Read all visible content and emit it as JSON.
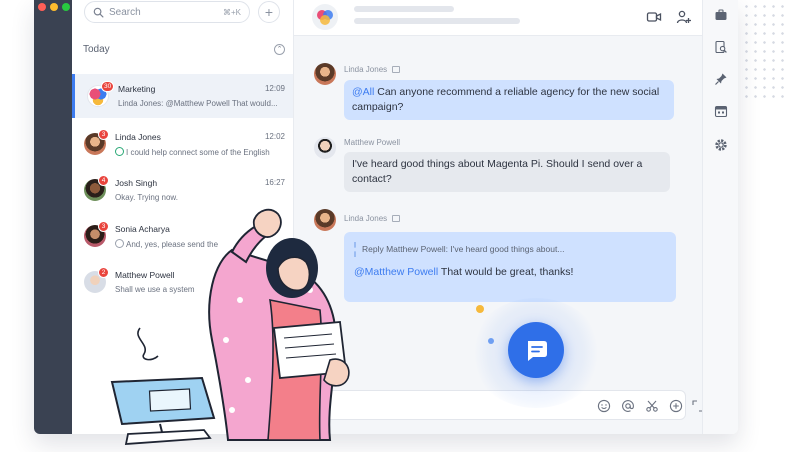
{
  "colors": {
    "accent": "#3d7cf0",
    "rail": "#3a4252",
    "badge": "#e9443d",
    "bubble_mine": "#cfe1ff",
    "bubble_other": "#e6e9ee"
  },
  "search": {
    "placeholder": "Search",
    "shortcut": "⌘+K"
  },
  "sidebar": {
    "section_label": "Today",
    "conversations": [
      {
        "name": "Marketing",
        "time": "12:09",
        "preview": "Linda Jones: @Matthew Powell That would...",
        "badge": "30",
        "active": true
      },
      {
        "name": "Linda Jones",
        "time": "12:02",
        "preview": "I could help connect some of the English",
        "badge": "3",
        "active": false
      },
      {
        "name": "Josh Singh",
        "time": "16:27",
        "preview": "Okay. Trying now.",
        "badge": "4",
        "active": false
      },
      {
        "name": "Sonia Acharya",
        "time": "",
        "preview": "And, yes, please send the",
        "badge": "3",
        "active": false
      },
      {
        "name": "Matthew Powell",
        "time": "",
        "preview": "Shall we use a system",
        "badge": "2",
        "active": false
      }
    ]
  },
  "chat": {
    "messages": [
      {
        "sender": "Linda Jones",
        "mention": "@All",
        "text": " Can anyone recommend a reliable agency for the new social campaign?"
      },
      {
        "sender": "Matthew Powell",
        "text": "I've heard good things about Magenta Pi. Should I send over a contact?"
      },
      {
        "sender": "Linda Jones",
        "reply": "Reply Matthew Powell: I've heard good things about...",
        "mention": "@Matthew Powell",
        "text": " That would be great, thanks!"
      }
    ]
  },
  "icons": {
    "header": [
      "video-icon",
      "add-user-icon",
      "check-icon"
    ],
    "rightbar": [
      "briefcase-icon",
      "search-document-icon",
      "pin-icon",
      "calendar-icon",
      "settings-icon"
    ],
    "composer": [
      "emoji-icon",
      "mention-icon",
      "scissors-icon",
      "add-icon",
      "expand-icon"
    ]
  }
}
